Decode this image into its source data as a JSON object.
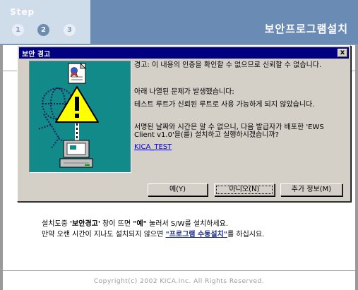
{
  "header": {
    "step_label": "Step",
    "steps": [
      "1",
      "2",
      "3"
    ],
    "active_step": "2",
    "title": "보안프로그램설치"
  },
  "dialog": {
    "title": "보안 경고",
    "close_label": "x",
    "message_1": "경고: 이 내용의 인증을 확인할 수 없으므로 신뢰할 수 없습니다.",
    "message_2": "아래 나열된 문제가 발생했습니다:",
    "message_3": "테스트 루트가 신뢰된 루트로 사용 가능하게 되지 않았습니다.",
    "message_4": "서명된 날짜와 시간은 알 수 없으니, 다음 발급자가 배포한 'EWS Client v1.0'을(를) 설치하고 실행하시겠습니까?",
    "link": "KICA_TEST",
    "buttons": {
      "yes": "예(Y)",
      "no": "아니오(N)",
      "more_info": "추가 정보(M)"
    },
    "icons": [
      "certificate-icon",
      "warning-icon",
      "computer-icon"
    ]
  },
  "instructions": {
    "line1_prefix": "설치도중 ",
    "line1_bold1": "'보안경고'",
    "line1_mid": " 창이 뜨면 ",
    "line1_bold2": "\"예\"",
    "line1_suffix": " 눌러서 S/W를 설치하세요.",
    "line2_prefix": "만약 오랜 시간이 지나도 설치되지 않으면 ",
    "line2_link": "\"프로그램 수동설치\"",
    "line2_suffix": "를 하십시요."
  },
  "footer": {
    "copyright": "Copyright(c) 2002 KICA.Inc. All Rights Reserved."
  },
  "colors": {
    "header_blue": "#6a8bb3",
    "header_light": "#cfdcea",
    "dialog_title_bar": "#000080",
    "dialog_face": "#d4d0c8",
    "image_bg": "#128a8a",
    "link_blue": "#0000ee"
  }
}
